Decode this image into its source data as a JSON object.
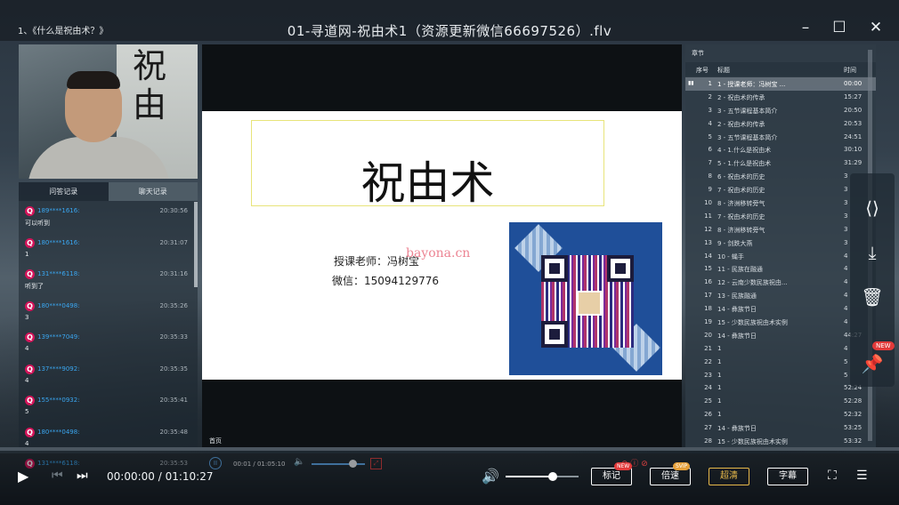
{
  "window": {
    "course_title": "1、《什么是祝由术？》",
    "file_title": "01-寻道网-祝由术1（资源更新微信66697526）.flv",
    "minimize_icon": "minimize-icon",
    "maximize_icon": "maximize-icon",
    "close_icon": "close-icon"
  },
  "chat": {
    "tabs": [
      "问答记录",
      "聊天记录"
    ],
    "messages": [
      {
        "user": "189****1616:",
        "time": "20:30:56",
        "text": "可以听到"
      },
      {
        "user": "180****1616:",
        "time": "20:31:07",
        "text": "1"
      },
      {
        "user": "131****6118:",
        "time": "20:31:16",
        "text": "听到了"
      },
      {
        "user": "180****0498:",
        "time": "20:35:26",
        "text": "3"
      },
      {
        "user": "139****7049:",
        "time": "20:35:33",
        "text": "4"
      },
      {
        "user": "137****9092:",
        "time": "20:35:35",
        "text": "4"
      },
      {
        "user": "155****0932:",
        "time": "20:35:41",
        "text": "5"
      },
      {
        "user": "180****0498:",
        "time": "20:35:48",
        "text": "4"
      },
      {
        "user": "131****6118:",
        "time": "20:35:53",
        "text": ""
      }
    ]
  },
  "slide": {
    "title": "祝由术",
    "teacher": "授课老师：冯树宝",
    "wechat": "微信：15094129776",
    "watermark": "bayona.cn"
  },
  "inner_player": {
    "label": "首页",
    "time": "00:01 / 01:05:10"
  },
  "chapters": {
    "header": "章节",
    "columns": {
      "index": "序号",
      "title": "标题",
      "time": "时间"
    },
    "rows": [
      {
        "index": "1",
        "title": "1 - 授课老师：冯树宝 ...",
        "time": "00:00",
        "active": true
      },
      {
        "index": "2",
        "title": "2 - 祝由术的传承",
        "time": "15:27"
      },
      {
        "index": "3",
        "title": "3 - 五节课程基本简介",
        "time": "20:50"
      },
      {
        "index": "4",
        "title": "2 - 祝由术的传承",
        "time": "20:53"
      },
      {
        "index": "5",
        "title": "3 - 五节课程基本简介",
        "time": "24:51"
      },
      {
        "index": "6",
        "title": "4 - 1.什么是祝由术",
        "time": "30:10"
      },
      {
        "index": "7",
        "title": "5 - 1.什么是祝由术",
        "time": "31:29"
      },
      {
        "index": "8",
        "title": "6 - 祝由术的历史",
        "time": "3"
      },
      {
        "index": "9",
        "title": "7 - 祝由术的历史",
        "time": "3"
      },
      {
        "index": "10",
        "title": "8 - 济洲移转旁气",
        "time": "3"
      },
      {
        "index": "11",
        "title": "7 - 祝由术的历史",
        "time": "3"
      },
      {
        "index": "12",
        "title": "8 - 济洲移转旁气",
        "time": "3"
      },
      {
        "index": "13",
        "title": "9 - 剑跌大燕",
        "time": "3"
      },
      {
        "index": "14",
        "title": "10 - 蝇手",
        "time": "4"
      },
      {
        "index": "15",
        "title": "11 - 民族在融通",
        "time": "4"
      },
      {
        "index": "16",
        "title": "12 - 云南少数民族祝由...",
        "time": "4"
      },
      {
        "index": "17",
        "title": "13 - 民族融通",
        "time": "4"
      },
      {
        "index": "18",
        "title": "14 - 彝族节日",
        "time": "4"
      },
      {
        "index": "19",
        "title": "15 - 少数民族祝由术实例",
        "time": "4"
      },
      {
        "index": "20",
        "title": "14 - 彝族节日",
        "time": "44:27"
      },
      {
        "index": "21",
        "title": "1",
        "time": "4"
      },
      {
        "index": "22",
        "title": "1",
        "time": "5"
      },
      {
        "index": "23",
        "title": "1",
        "time": "5"
      },
      {
        "index": "24",
        "title": "1",
        "time": "52:24"
      },
      {
        "index": "25",
        "title": "1",
        "time": "52:28"
      },
      {
        "index": "26",
        "title": "1",
        "time": "52:32"
      },
      {
        "index": "27",
        "title": "14 - 彝族节日",
        "time": "53:25"
      },
      {
        "index": "28",
        "title": "15 - 少数民族祝由术实例",
        "time": "53:32"
      }
    ]
  },
  "side_tools": {
    "share_icon": "share-icon",
    "download_icon": "download-icon",
    "delete_icon": "trash-icon",
    "pin_icon": "pin-icon",
    "new_badge": "NEW"
  },
  "controls": {
    "time": "00:00:00 / 01:10:27",
    "progress": 0.0,
    "volume": 0.65,
    "btn_mark": "标记",
    "btn_mark_badge": "NEW",
    "btn_speed": "倍速",
    "btn_speed_badge": "SVIP",
    "btn_quality": "超清",
    "btn_subtitle": "字幕"
  },
  "colors": {
    "accent": "#2ea3f2",
    "gold": "#e7b84a",
    "badge_red": "#e23a3a"
  }
}
